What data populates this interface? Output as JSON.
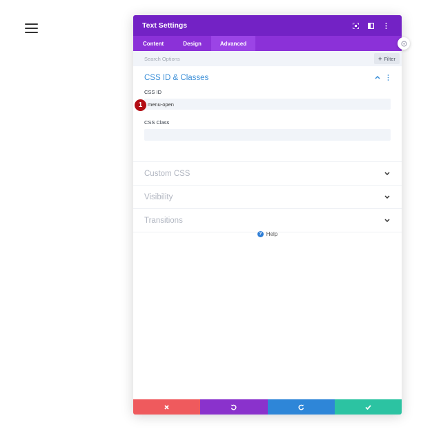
{
  "modal": {
    "title": "Text Settings",
    "tabs": [
      {
        "label": "Content",
        "active": false
      },
      {
        "label": "Design",
        "active": false
      },
      {
        "label": "Advanced",
        "active": true
      }
    ],
    "search": {
      "placeholder": "Search Options",
      "value": ""
    },
    "filter_label": "Filter",
    "sections": {
      "css_id_classes": {
        "title": "CSS ID & Classes",
        "expanded": true,
        "css_id_label": "CSS ID",
        "css_id_value": "menu-open",
        "css_class_label": "CSS Class",
        "css_class_value": ""
      },
      "custom_css": {
        "title": "Custom CSS"
      },
      "visibility": {
        "title": "Visibility"
      },
      "transitions": {
        "title": "Transitions"
      }
    },
    "help_label": "Help",
    "marker_number": "1",
    "footer": {
      "buttons": [
        {
          "icon": "close-icon",
          "color": "#ef5a5d"
        },
        {
          "icon": "undo-icon",
          "color": "#8a32cc"
        },
        {
          "icon": "redo-icon",
          "color": "#2e86d8"
        },
        {
          "icon": "check-icon",
          "color": "#2cc3a2"
        }
      ]
    }
  },
  "colors": {
    "header": "#7322c5",
    "tabs_bar": "#8b31d8",
    "active_tab": "#9b44e6",
    "accent_blue": "#3b8fd8",
    "marker": "#b30d14"
  }
}
